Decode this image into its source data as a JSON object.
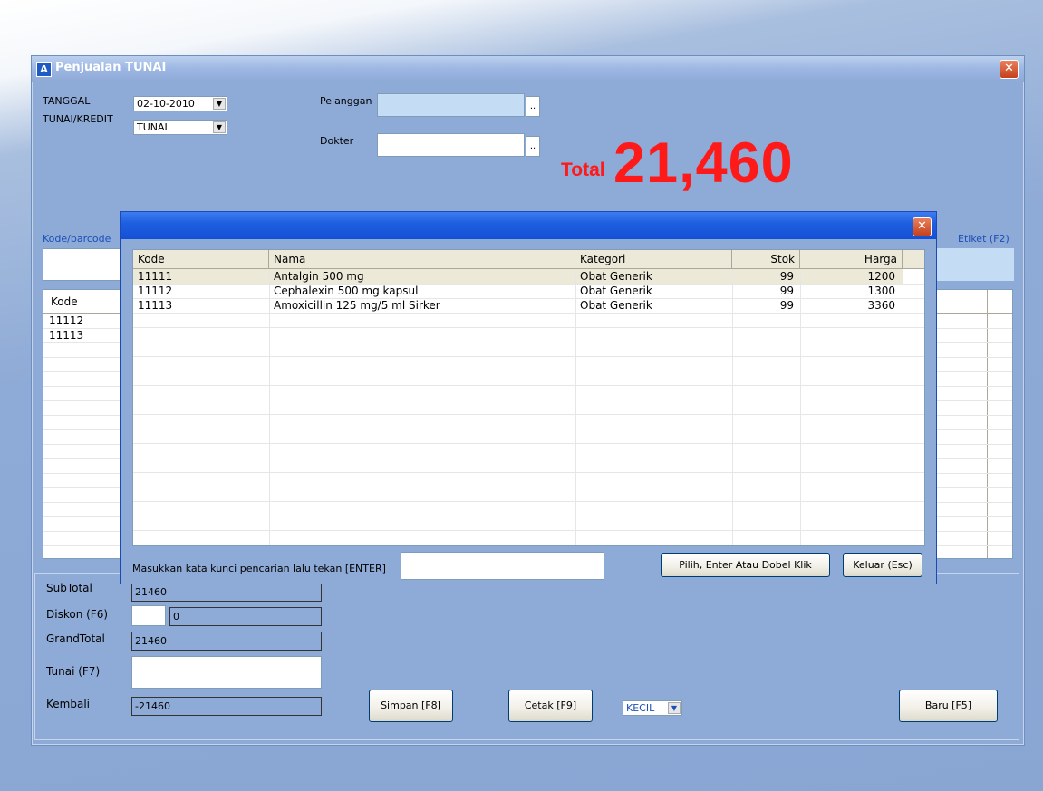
{
  "main": {
    "title": "Penjualan TUNAI",
    "icon_letter": "A",
    "close_glyph": "✕",
    "tanggal_label": "TANGGAL",
    "tanggal_value": "02-10-2010",
    "tunai_kredit_label": "TUNAI/KREDIT",
    "tunai_kredit_value": "TUNAI",
    "pelanggan_label": "Pelanggan",
    "dokter_label": "Dokter",
    "dots": "..",
    "total_label": "Total",
    "total_value": "21,460",
    "kode_barcode_label": "Kode/barcode",
    "etiket_label": "Etiket (F2)",
    "grid": {
      "header_kode": "Kode",
      "rows": [
        "11112",
        "11113"
      ]
    },
    "subtotal_label": "SubTotal",
    "subtotal_value": "21460",
    "diskon_label": "Diskon (F6)",
    "diskon_value": "0",
    "grandtotal_label": "GrandTotal",
    "grandtotal_value": "21460",
    "tunai_label": "Tunai (F7)",
    "kembali_label": "Kembali",
    "kembali_value": "-21460",
    "simpan_button": "Simpan [F8]",
    "cetak_button": "Cetak [F9]",
    "print_size_value": "KECIL",
    "baru_button": "Baru [F5]"
  },
  "dialog": {
    "close_glyph": "✕",
    "columns": [
      "Kode",
      "Nama",
      "Kategori",
      "Stok",
      "Harga"
    ],
    "rows": [
      {
        "kode": "11111",
        "nama": "Antalgin 500 mg",
        "kategori": "Obat Generik",
        "stok": "99",
        "harga": "1200"
      },
      {
        "kode": "11112",
        "nama": "Cephalexin 500 mg kapsul",
        "kategori": "Obat Generik",
        "stok": "99",
        "harga": "1300"
      },
      {
        "kode": "11113",
        "nama": "Amoxicillin 125 mg/5 ml Sirker",
        "kategori": "Obat Generik",
        "stok": "99",
        "harga": "3360"
      }
    ],
    "search_label": "Masukkan kata kunci pencarian lalu tekan [ENTER]",
    "pilih_button": "Pilih, Enter Atau Dobel Klik",
    "keluar_button": "Keluar (Esc)"
  },
  "colors": {
    "total_red": "#ff1a1a",
    "window_blue": "#8eaad6",
    "dialog_title_blue": "#1e5fe0",
    "selected_row": "#ece9d8"
  }
}
